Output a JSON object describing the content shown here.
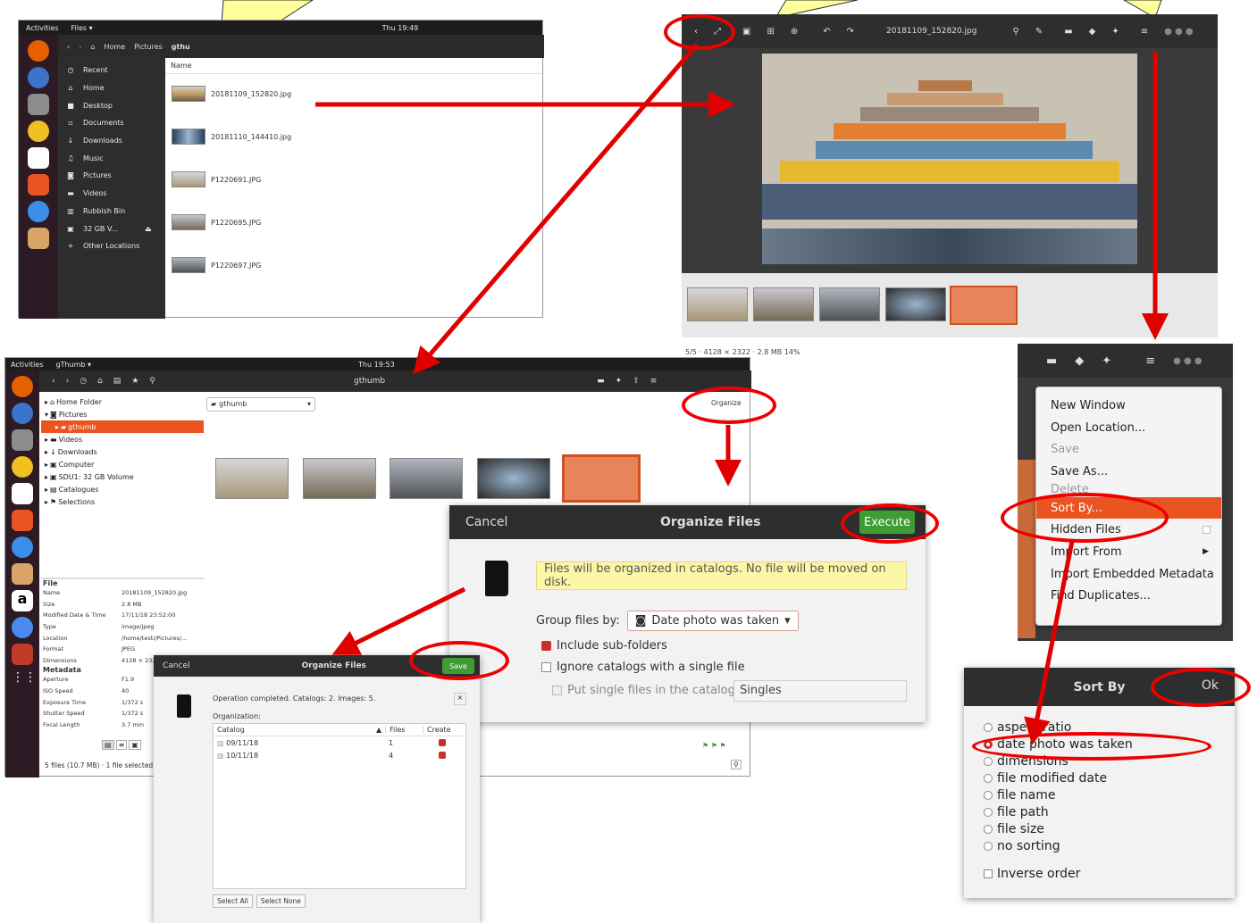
{
  "files_window": {
    "activities": "Activities",
    "app_menu": "Files ▾",
    "clock": "Thu 19:49",
    "breadcrumb": [
      "Home",
      "Pictures",
      "gthu"
    ],
    "column_name": "Name",
    "sidebar": [
      "Recent",
      "Home",
      "Desktop",
      "Documents",
      "Downloads",
      "Music",
      "Pictures",
      "Videos",
      "Rubbish Bin",
      "32 GB V...",
      "Other Locations"
    ],
    "files": [
      "20181109_152820.jpg",
      "20181110_144410.jpg",
      "P1220691.JPG",
      "P1220695.JPG",
      "P1220697.JPG"
    ]
  },
  "viewer_window": {
    "title": "20181109_152820.jpg",
    "status": "5/5  ·  4128 × 2322  ·  2.8 MB     14%"
  },
  "main_menu": {
    "items": [
      "New Window",
      "Open Location...",
      "Save",
      "Save As...",
      "Delete",
      "Sort By...",
      "Hidden Files",
      "Import From",
      "Import Embedded Metadata",
      "Find Duplicates..."
    ]
  },
  "browser_window": {
    "activities": "Activities",
    "app_menu": "gThumb ▾",
    "clock": "Thu 19:53",
    "title": "gthumb",
    "folder_select": "gthumb",
    "organize_label": "Organize",
    "tree": [
      "Home Folder",
      "Pictures",
      "gthumb",
      "Videos",
      "Downloads",
      "Computer",
      "SDU1: 32 GB Volume",
      "Catalogues",
      "Selections"
    ],
    "file_heading": "File",
    "metadata_heading": "Metadata",
    "properties": [
      {
        "k": "Name",
        "v": "20181109_152820.jpg"
      },
      {
        "k": "Size",
        "v": "2.8 MB"
      },
      {
        "k": "Modified Date & Time",
        "v": "17/11/18 23:52:00"
      },
      {
        "k": "Type",
        "v": "image/jpeg"
      },
      {
        "k": "Location",
        "v": "/home/testi/Pictures/..."
      },
      {
        "k": "Format",
        "v": "JPEG"
      },
      {
        "k": "Dimensions",
        "v": "4128 × 2322"
      }
    ],
    "metadata": [
      {
        "k": "Aperture",
        "v": "F1.9"
      },
      {
        "k": "ISO Speed",
        "v": "40"
      },
      {
        "k": "Exposure Time",
        "v": "1/372 s"
      },
      {
        "k": "Shutter Speed",
        "v": "1/372 s"
      },
      {
        "k": "Focal Length",
        "v": "3.7 mm"
      }
    ],
    "status": "5 files (10.7 MB) · 1 file selected"
  },
  "organize_dialog": {
    "cancel": "Cancel",
    "title": "Organize Files",
    "execute": "Execute",
    "info": "Files will be organized in catalogs. No file will be moved on disk.",
    "group_label": "Group files by:",
    "group_value": "Date photo was taken",
    "include_sub": "Include sub-folders",
    "ignore_single": "Ignore catalogs with a single file",
    "put_single": "Put single files in the catalog:",
    "singles_value": "Singles"
  },
  "result_dialog": {
    "cancel": "Cancel",
    "title": "Organize Files",
    "save": "Save",
    "message": "Operation completed. Catalogs: 2. Images: 5.",
    "org_label": "Organization:",
    "col_catalog": "Catalog",
    "col_files": "Files",
    "col_create": "Create",
    "rows": [
      {
        "catalog": "09/11/18",
        "files": "1"
      },
      {
        "catalog": "10/11/18",
        "files": "4"
      }
    ],
    "select_all": "Select All",
    "select_none": "Select None"
  },
  "sort_dialog": {
    "title": "Sort By",
    "ok": "Ok",
    "options": [
      "aspect ratio",
      "date photo was taken",
      "dimensions",
      "file modified date",
      "file name",
      "file path",
      "file size",
      "no sorting"
    ],
    "selected_index": 1,
    "inverse": "Inverse order"
  },
  "colors": {
    "accent": "#e95420",
    "arrow": "#e00000",
    "callout": "#ffff99",
    "execute": "#3f9c35"
  }
}
